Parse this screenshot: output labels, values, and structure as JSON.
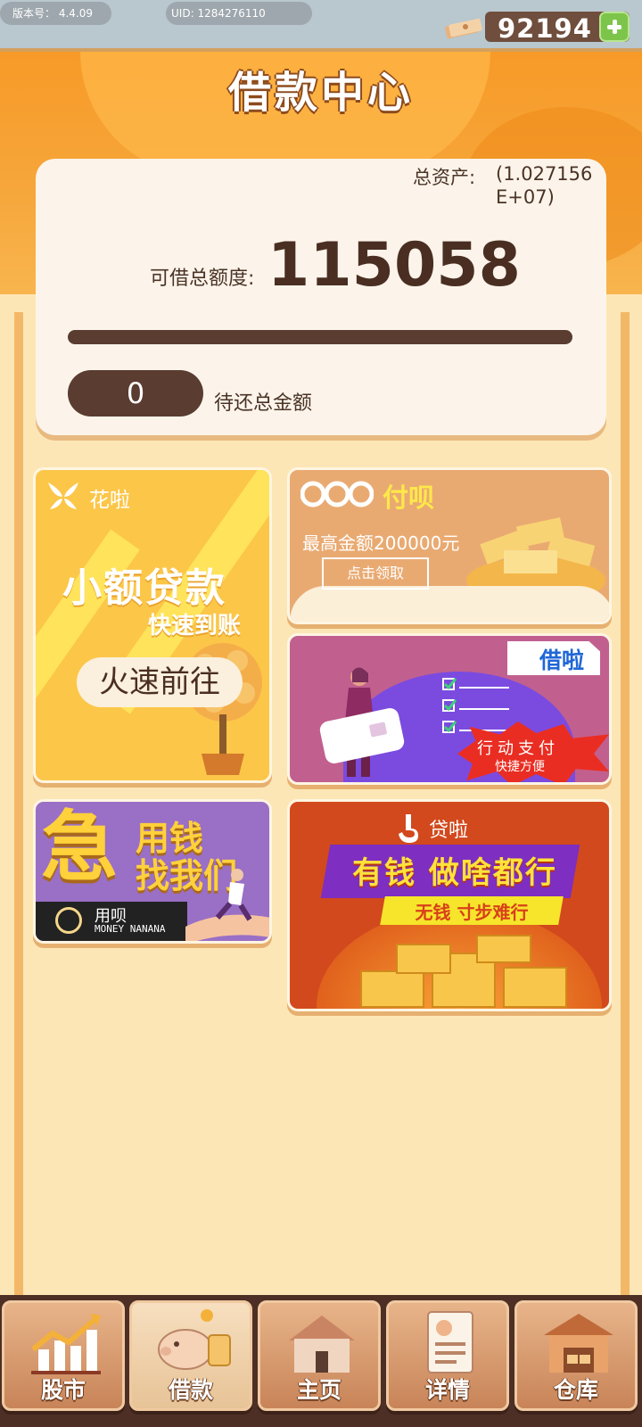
{
  "status": {
    "version_label": "版本号：",
    "version_value": "4.4.09",
    "uid_label": "UID:",
    "uid_value": "1284276110",
    "coins": "92194"
  },
  "header": {
    "title": "借款中心"
  },
  "summary": {
    "assets_label": "总资产:",
    "assets_value": "(1.027156E+07)",
    "limit_label": "可借总额度:",
    "limit_value": "115058",
    "owed_value": "0",
    "owed_label": "待还总金额"
  },
  "cards": {
    "huala": {
      "brand": "花啦",
      "title": "小额贷款",
      "subtitle": "快速到账",
      "button": "火速前往"
    },
    "fubei": {
      "brand": "付呗",
      "text": "最高金额200000元",
      "button": "点击领取"
    },
    "jiela": {
      "brand": "借啦",
      "slogan": "行动支付",
      "subslogan": "快捷方便"
    },
    "yongbei": {
      "big_char": "急",
      "line1": "用钱",
      "line2": "找我们",
      "brand": "用呗",
      "brand_en": "MONEY NANANA"
    },
    "daila": {
      "brand": "贷啦",
      "line1": "有钱 做啥都行",
      "line2": "无钱 寸步难行"
    }
  },
  "nav": [
    {
      "label": "股市",
      "icon": "stock-chart-icon",
      "active": false
    },
    {
      "label": "借款",
      "icon": "piggy-bank-icon",
      "active": true
    },
    {
      "label": "主页",
      "icon": "house-icon",
      "active": false
    },
    {
      "label": "详情",
      "icon": "profile-document-icon",
      "active": false
    },
    {
      "label": "仓库",
      "icon": "warehouse-icon",
      "active": false
    }
  ],
  "colors": {
    "header_orange": "#f79a28",
    "panel_bg": "#fde6b6",
    "dark_brown": "#5a3c30",
    "nav_bg": "#4d2f25",
    "add_green": "#7cc54a"
  }
}
